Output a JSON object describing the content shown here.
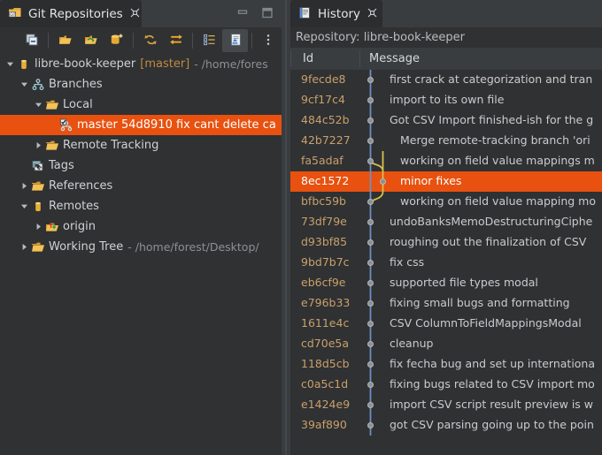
{
  "theme": {
    "bg": "#2f3133",
    "panel": "#3a3d3f",
    "tab_active": "#2b2d2f",
    "selection": "#e8510f",
    "text": "#cfd2d4",
    "muted": "#8d9093",
    "sha": "#c9a06a",
    "branch_label": "#c08a3e",
    "graph_main": "#6f8fc0",
    "graph_merge": "#d8c04a"
  },
  "git_repositories": {
    "tab": {
      "title": "Git Repositories",
      "icon": "git-repository-icon",
      "close": "✖"
    },
    "window_buttons": {
      "minimize": "minimize-icon",
      "maximize": "maximize-icon"
    },
    "toolbar": [
      {
        "name": "collapse-all-button",
        "icon": "collapse-all-icon"
      },
      {
        "name": "add-repository-button",
        "icon": "add-existing-repository-icon"
      },
      {
        "name": "clone-repository-button",
        "icon": "clone-repository-icon"
      },
      {
        "name": "create-repository-button",
        "icon": "create-new-repository-icon"
      },
      {
        "name": "pull-button",
        "icon": "pull-icon"
      },
      {
        "name": "push-button",
        "icon": "push-icon"
      },
      {
        "name": "link-with-selection-button",
        "icon": "link-with-editor-icon"
      },
      {
        "name": "toggle-branch-hierarchy-button",
        "icon": "branch-hierarchy-icon"
      },
      {
        "name": "view-menu-button",
        "icon": "view-menu-icon"
      }
    ],
    "tree": [
      {
        "level": 0,
        "twisty": "expanded",
        "icon": "repository-icon",
        "label": "libre-book-keeper",
        "branch": "[master]",
        "sub": "- /home/fores",
        "selected": false
      },
      {
        "level": 1,
        "twisty": "expanded",
        "icon": "branches-icon",
        "label": "Branches",
        "branch": "",
        "sub": "",
        "selected": false
      },
      {
        "level": 2,
        "twisty": "expanded",
        "icon": "folder-open-icon",
        "label": "Local",
        "branch": "",
        "sub": "",
        "selected": false
      },
      {
        "level": 3,
        "twisty": "none",
        "icon": "checked-out-branch-icon",
        "label": "master 54d8910 fix cant delete ca",
        "branch": "",
        "sub": "",
        "selected": true
      },
      {
        "level": 2,
        "twisty": "collapsed",
        "icon": "folder-open-icon",
        "label": "Remote Tracking",
        "branch": "",
        "sub": "",
        "selected": false
      },
      {
        "level": 1,
        "twisty": "none",
        "icon": "tags-icon",
        "label": "Tags",
        "branch": "",
        "sub": "",
        "selected": false
      },
      {
        "level": 1,
        "twisty": "collapsed",
        "icon": "folder-open-icon",
        "label": "References",
        "branch": "",
        "sub": "",
        "selected": false
      },
      {
        "level": 1,
        "twisty": "expanded",
        "icon": "repository-icon",
        "label": "Remotes",
        "branch": "",
        "sub": "",
        "selected": false
      },
      {
        "level": 2,
        "twisty": "collapsed",
        "icon": "remote-icon",
        "label": "origin",
        "branch": "",
        "sub": "",
        "selected": false
      },
      {
        "level": 1,
        "twisty": "collapsed",
        "icon": "folder-open-icon",
        "label": "Working Tree",
        "branch": "",
        "sub": "- /home/forest/Desktop/",
        "selected": false
      }
    ]
  },
  "history": {
    "tab": {
      "title": "History",
      "icon": "history-icon",
      "close": "✖"
    },
    "repository_line": "Repository: libre-book-keeper",
    "columns": [
      "Id",
      "Message"
    ],
    "rows": [
      {
        "id": "9fecde8",
        "message": "first crack at categorization and tran",
        "indent": false,
        "lane": 1,
        "selected": false
      },
      {
        "id": "9cf17c4",
        "message": "import to its own file",
        "indent": false,
        "lane": 1,
        "selected": false
      },
      {
        "id": "484c52b",
        "message": "Got CSV Import finished-ish for the g",
        "indent": false,
        "lane": 1,
        "selected": false
      },
      {
        "id": "42b7227",
        "message": "Merge remote-tracking branch 'ori",
        "indent": true,
        "lane": 1,
        "selected": false
      },
      {
        "id": "fa5adaf",
        "message": "working on field value mappings m",
        "indent": true,
        "lane": 1,
        "selected": false
      },
      {
        "id": "8ec1572",
        "message": "minor fixes",
        "indent": true,
        "lane": 2,
        "selected": true
      },
      {
        "id": "bfbc59b",
        "message": "working on field value mapping mo",
        "indent": true,
        "lane": 1,
        "selected": false
      },
      {
        "id": "73df79e",
        "message": "undoBanksMemoDestructuringCiphe",
        "indent": false,
        "lane": 1,
        "selected": false
      },
      {
        "id": "d93bf85",
        "message": "roughing out the finalization of CSV ",
        "indent": false,
        "lane": 1,
        "selected": false
      },
      {
        "id": "9bd7b7c",
        "message": "fix css",
        "indent": false,
        "lane": 1,
        "selected": false
      },
      {
        "id": "eb6cf9e",
        "message": "supported file types modal",
        "indent": false,
        "lane": 1,
        "selected": false
      },
      {
        "id": "e796b33",
        "message": "fixing small bugs and formatting",
        "indent": false,
        "lane": 1,
        "selected": false
      },
      {
        "id": "1611e4c",
        "message": "CSV ColumnToFieldMappingsModal ",
        "indent": false,
        "lane": 1,
        "selected": false
      },
      {
        "id": "cd70e5a",
        "message": "cleanup",
        "indent": false,
        "lane": 1,
        "selected": false
      },
      {
        "id": "118d5cb",
        "message": "fix fecha bug and set up internationa",
        "indent": false,
        "lane": 1,
        "selected": false
      },
      {
        "id": "c0a5c1d",
        "message": "fixing bugs related to CSV import mo",
        "indent": false,
        "lane": 1,
        "selected": false
      },
      {
        "id": "e1424e9",
        "message": "import CSV script result preview is w",
        "indent": false,
        "lane": 1,
        "selected": false
      },
      {
        "id": "39af890",
        "message": "got CSV parsing going up to the poin",
        "indent": false,
        "lane": 1,
        "selected": false
      }
    ]
  }
}
